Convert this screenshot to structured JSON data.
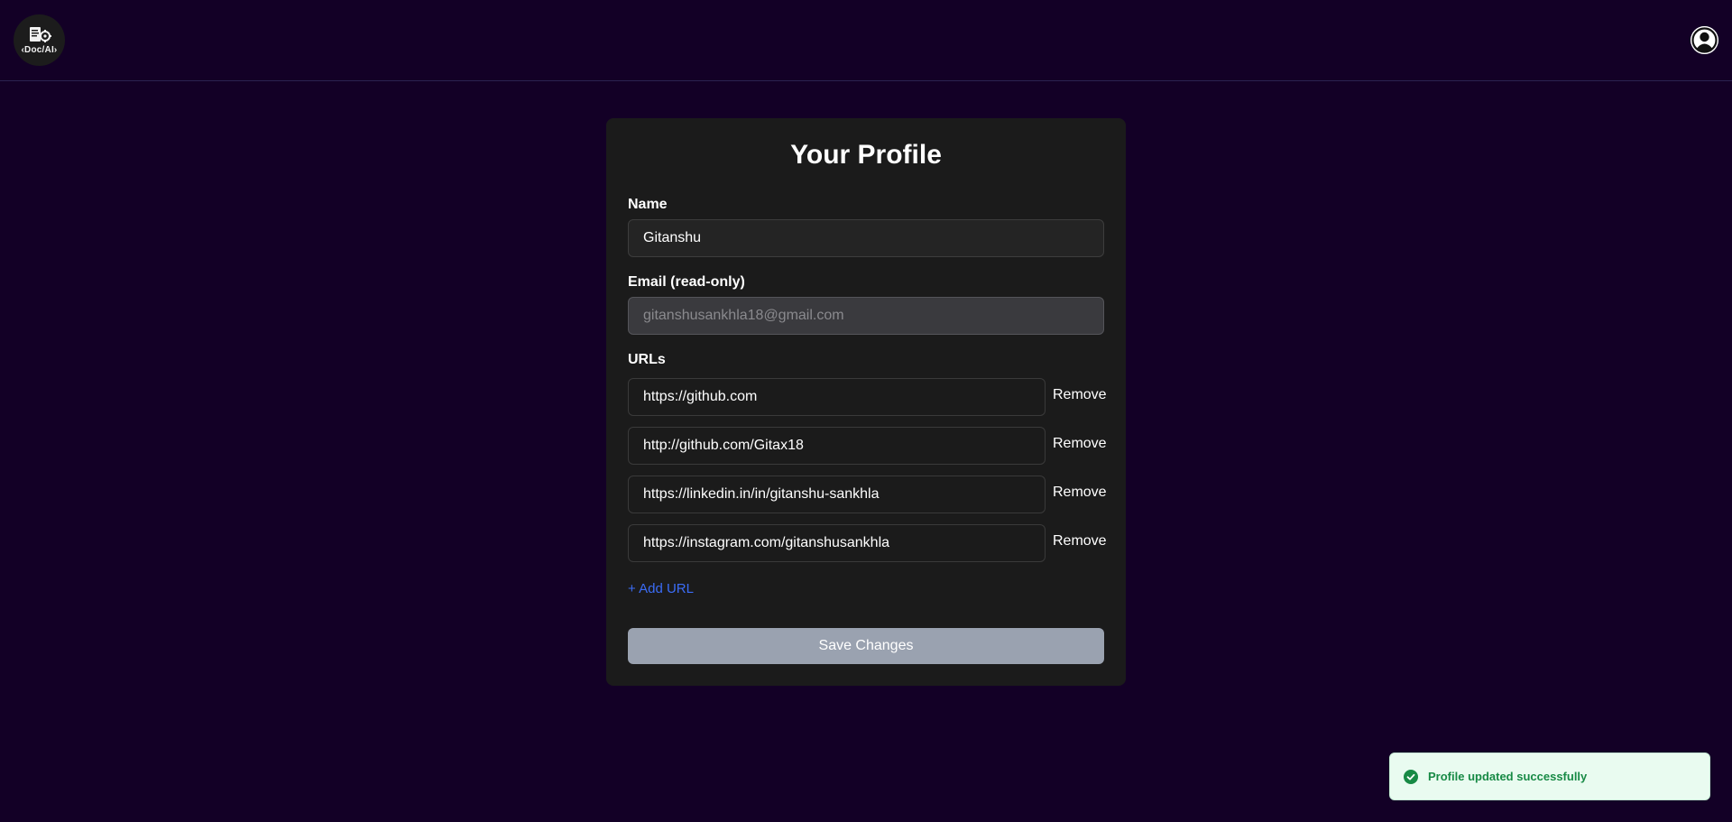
{
  "header": {
    "logo_text": "‹Doc/AI›"
  },
  "profile": {
    "title": "Your Profile",
    "name_label": "Name",
    "name_value": "Gitanshu",
    "email_label": "Email (read-only)",
    "email_value": "gitanshusankhla18@gmail.com",
    "urls_label": "URLs",
    "urls": [
      "https://github.com",
      "http://github.com/Gitax18",
      "https://linkedin.in/in/gitanshu-sankhla",
      "https://instagram.com/gitanshusankhla"
    ],
    "remove_label": "Remove",
    "add_url_label": "+ Add URL",
    "save_label": "Save Changes"
  },
  "toast": {
    "message": "Profile updated successfully",
    "color": "#178a45"
  }
}
